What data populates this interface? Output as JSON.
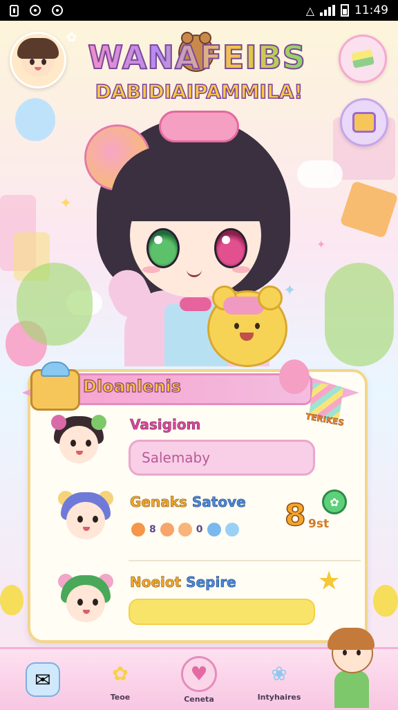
{
  "status_bar": {
    "time": "11:49"
  },
  "header": {
    "logo_line1": "WANAFEIBS",
    "logo_line2": "DABIDIAIPAMMILA!",
    "profile_avatar": "girl-avatar-icon",
    "right_buttons": [
      "cake-icon",
      "gift-box-icon"
    ]
  },
  "panel": {
    "ribbon_title": "Dloanlenis",
    "tag_text": "TERIKES",
    "rows": [
      {
        "title": "Vasigiom",
        "input_value": "Salemaby",
        "avatar": "pigtail-girl-avatar"
      },
      {
        "title_part1": "Genaks",
        "title_part2": "Satove",
        "score": "8",
        "score_unit": "9st",
        "gem_label_1": "8",
        "gem_label_2": "0",
        "avatar": "blue-hair-boy-avatar",
        "badge_icon": "leaf-icon"
      },
      {
        "title_part1": "Noeiot",
        "title_part2": "Sepire",
        "avatar": "green-hair-kid-avatar",
        "star_icon": "star-icon"
      }
    ]
  },
  "bottom_nav": [
    {
      "label": "Teoe",
      "icon": "gift-card-icon"
    },
    {
      "label": "Ceneta",
      "icon": "star-flower-icon"
    },
    {
      "label": "Intyhaires",
      "icon": "flower-icon"
    }
  ],
  "colors": {
    "accent_pink": "#f4a0c8",
    "panel_border": "#f4d58a",
    "score_orange": "#f5a52a"
  }
}
